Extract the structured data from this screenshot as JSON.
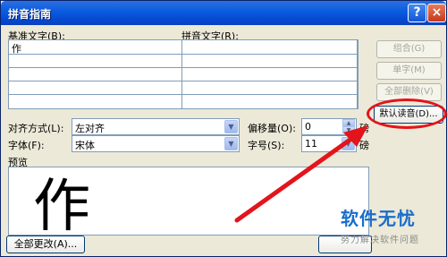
{
  "title": "拼音指南",
  "help_glyph": "?",
  "close_glyph": "×",
  "labels": {
    "base_text": "基准文字(B):",
    "ruby_text": "拼音文字(R):",
    "alignment": "对齐方式(L):",
    "offset": "偏移量(O):",
    "font": "字体(F):",
    "size": "字号(S):",
    "preview": "预览",
    "points_unit_1": "磅",
    "points_unit_2": "磅"
  },
  "grid": {
    "rows": [
      {
        "base": "作",
        "ruby": ""
      },
      {
        "base": "",
        "ruby": ""
      },
      {
        "base": "",
        "ruby": ""
      },
      {
        "base": "",
        "ruby": ""
      },
      {
        "base": "",
        "ruby": ""
      }
    ]
  },
  "side_buttons": {
    "combine": "组合(G)",
    "single": "单字(M)",
    "clear_all": "全部删除(V)",
    "default_reading": "默认读音(D)..."
  },
  "fields": {
    "alignment_value": "左对齐",
    "font_value": "宋体",
    "offset_value": "0",
    "size_value": "11"
  },
  "preview_char": "作",
  "bottom_buttons": {
    "change_all": "全部更改(A)..."
  },
  "watermark": {
    "title": "软件无忧",
    "subtitle": "努力解决软件问题"
  },
  "colors": {
    "titlebar": "#0548cf",
    "annotation": "#e3141b",
    "watermark": "#1a6ec9"
  }
}
